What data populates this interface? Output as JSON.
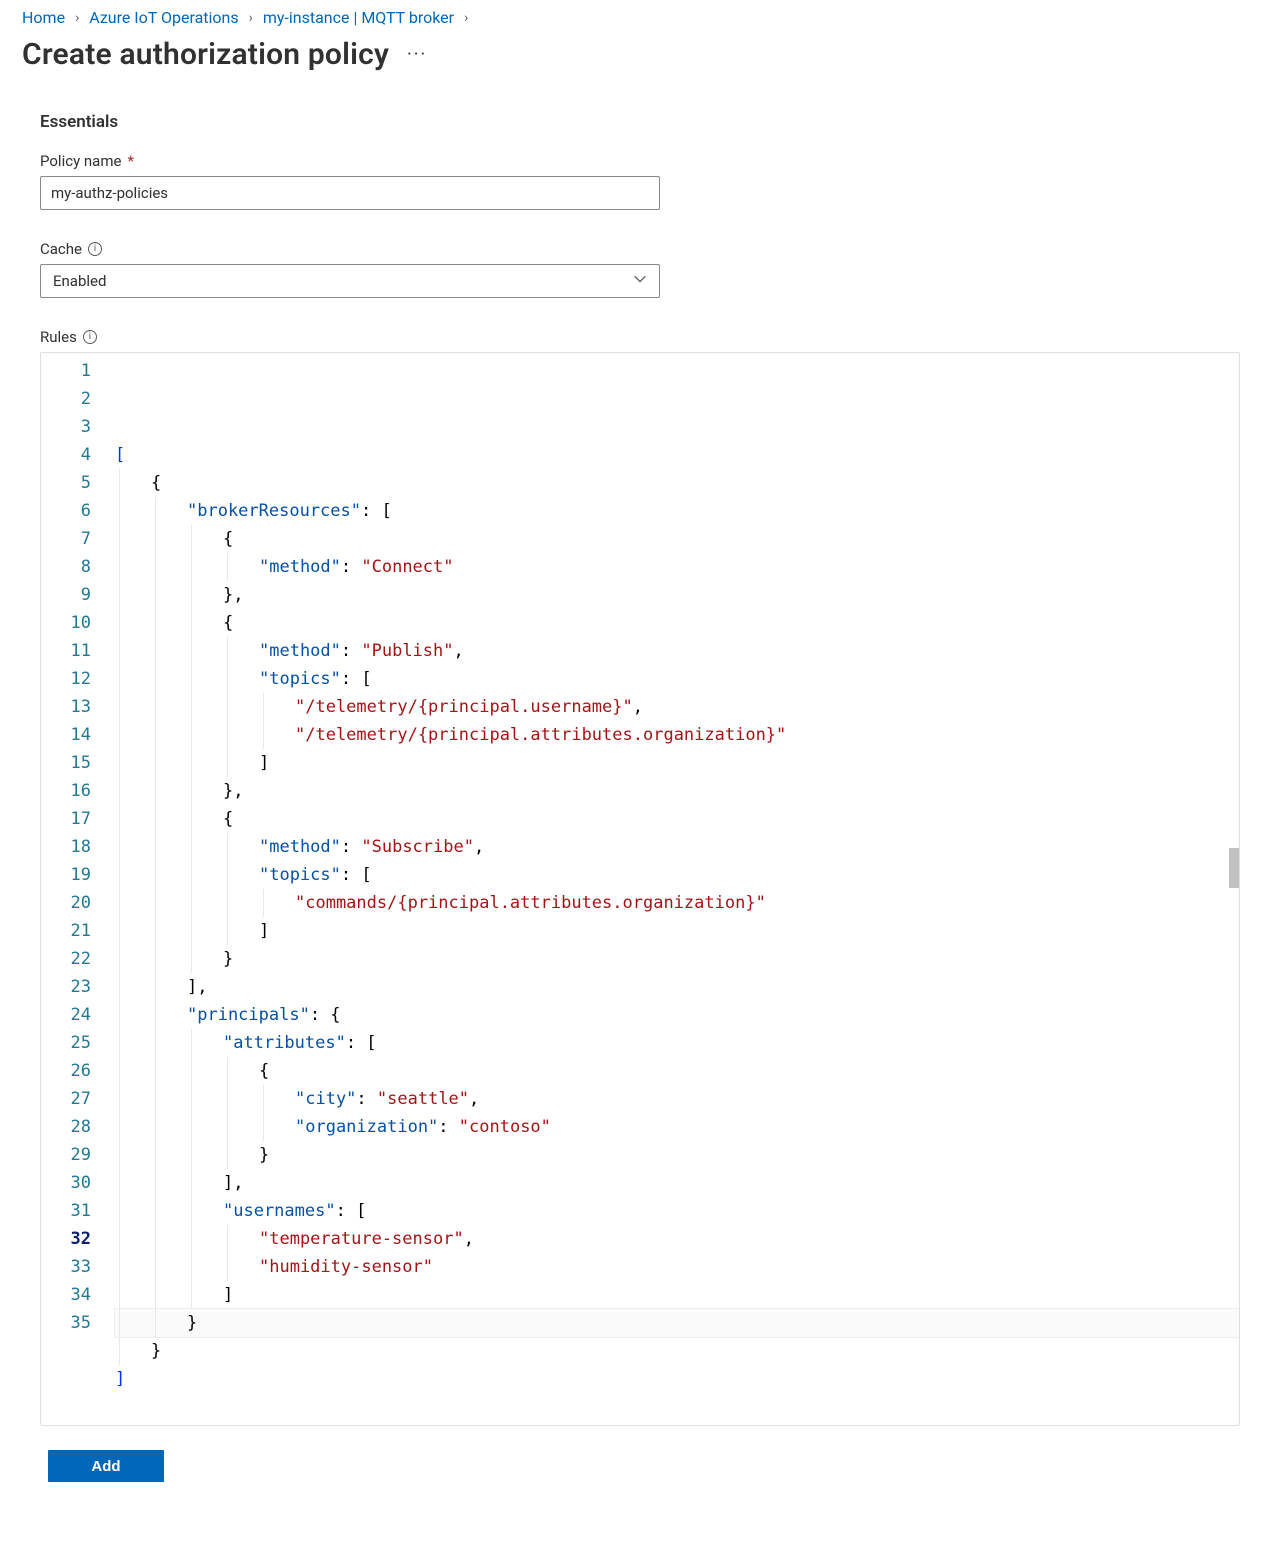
{
  "breadcrumbs": {
    "items": [
      {
        "label": "Home",
        "link": true
      },
      {
        "label": "Azure IoT Operations",
        "link": true
      },
      {
        "label": "my-instance | MQTT broker",
        "link": true
      }
    ]
  },
  "page": {
    "title": "Create authorization policy"
  },
  "essentials": {
    "heading": "Essentials",
    "policy_name_label": "Policy name",
    "policy_name_value": "my-authz-policies",
    "cache_label": "Cache",
    "cache_value": "Enabled"
  },
  "rules": {
    "label": "Rules"
  },
  "editor": {
    "current_line": 32,
    "lines": [
      {
        "n": 1,
        "indent": 0,
        "tokens": [
          [
            "brkt",
            "["
          ]
        ]
      },
      {
        "n": 2,
        "indent": 1,
        "tokens": [
          [
            "punc",
            "{"
          ]
        ]
      },
      {
        "n": 3,
        "indent": 2,
        "tokens": [
          [
            "prop",
            "\"brokerResources\""
          ],
          [
            "punc",
            ": ["
          ]
        ]
      },
      {
        "n": 4,
        "indent": 3,
        "tokens": [
          [
            "punc",
            "{"
          ]
        ]
      },
      {
        "n": 5,
        "indent": 4,
        "tokens": [
          [
            "prop",
            "\"method\""
          ],
          [
            "punc",
            ": "
          ],
          [
            "str",
            "\"Connect\""
          ]
        ]
      },
      {
        "n": 6,
        "indent": 3,
        "tokens": [
          [
            "punc",
            "},"
          ]
        ]
      },
      {
        "n": 7,
        "indent": 3,
        "tokens": [
          [
            "punc",
            "{"
          ]
        ]
      },
      {
        "n": 8,
        "indent": 4,
        "tokens": [
          [
            "prop",
            "\"method\""
          ],
          [
            "punc",
            ": "
          ],
          [
            "str",
            "\"Publish\""
          ],
          [
            "punc",
            ","
          ]
        ]
      },
      {
        "n": 9,
        "indent": 4,
        "tokens": [
          [
            "prop",
            "\"topics\""
          ],
          [
            "punc",
            ": ["
          ]
        ]
      },
      {
        "n": 10,
        "indent": 5,
        "tokens": [
          [
            "str",
            "\"/telemetry/{principal.username}\""
          ],
          [
            "punc",
            ","
          ]
        ]
      },
      {
        "n": 11,
        "indent": 5,
        "tokens": [
          [
            "str",
            "\"/telemetry/{principal.attributes.organization}\""
          ]
        ]
      },
      {
        "n": 12,
        "indent": 4,
        "tokens": [
          [
            "punc",
            "]"
          ]
        ]
      },
      {
        "n": 13,
        "indent": 3,
        "tokens": [
          [
            "punc",
            "},"
          ]
        ]
      },
      {
        "n": 14,
        "indent": 3,
        "tokens": [
          [
            "punc",
            "{"
          ]
        ]
      },
      {
        "n": 15,
        "indent": 4,
        "tokens": [
          [
            "prop",
            "\"method\""
          ],
          [
            "punc",
            ": "
          ],
          [
            "str",
            "\"Subscribe\""
          ],
          [
            "punc",
            ","
          ]
        ]
      },
      {
        "n": 16,
        "indent": 4,
        "tokens": [
          [
            "prop",
            "\"topics\""
          ],
          [
            "punc",
            ": ["
          ]
        ]
      },
      {
        "n": 17,
        "indent": 5,
        "tokens": [
          [
            "str",
            "\"commands/{principal.attributes.organization}\""
          ]
        ]
      },
      {
        "n": 18,
        "indent": 4,
        "tokens": [
          [
            "punc",
            "]"
          ]
        ]
      },
      {
        "n": 19,
        "indent": 3,
        "tokens": [
          [
            "punc",
            "}"
          ]
        ]
      },
      {
        "n": 20,
        "indent": 2,
        "tokens": [
          [
            "punc",
            "],"
          ]
        ]
      },
      {
        "n": 21,
        "indent": 2,
        "tokens": [
          [
            "prop",
            "\"principals\""
          ],
          [
            "punc",
            ": {"
          ]
        ]
      },
      {
        "n": 22,
        "indent": 3,
        "tokens": [
          [
            "prop",
            "\"attributes\""
          ],
          [
            "punc",
            ": ["
          ]
        ]
      },
      {
        "n": 23,
        "indent": 4,
        "tokens": [
          [
            "punc",
            "{"
          ]
        ]
      },
      {
        "n": 24,
        "indent": 5,
        "tokens": [
          [
            "prop",
            "\"city\""
          ],
          [
            "punc",
            ": "
          ],
          [
            "str",
            "\"seattle\""
          ],
          [
            "punc",
            ","
          ]
        ]
      },
      {
        "n": 25,
        "indent": 5,
        "tokens": [
          [
            "prop",
            "\"organization\""
          ],
          [
            "punc",
            ": "
          ],
          [
            "str",
            "\"contoso\""
          ]
        ]
      },
      {
        "n": 26,
        "indent": 4,
        "tokens": [
          [
            "punc",
            "}"
          ]
        ]
      },
      {
        "n": 27,
        "indent": 3,
        "tokens": [
          [
            "punc",
            "],"
          ]
        ]
      },
      {
        "n": 28,
        "indent": 3,
        "tokens": [
          [
            "prop",
            "\"usernames\""
          ],
          [
            "punc",
            ": ["
          ]
        ]
      },
      {
        "n": 29,
        "indent": 4,
        "tokens": [
          [
            "str",
            "\"temperature-sensor\""
          ],
          [
            "punc",
            ","
          ]
        ]
      },
      {
        "n": 30,
        "indent": 4,
        "tokens": [
          [
            "str",
            "\"humidity-sensor\""
          ]
        ]
      },
      {
        "n": 31,
        "indent": 3,
        "tokens": [
          [
            "punc",
            "]"
          ]
        ]
      },
      {
        "n": 32,
        "indent": 2,
        "tokens": [
          [
            "punc",
            "}"
          ]
        ]
      },
      {
        "n": 33,
        "indent": 1,
        "tokens": [
          [
            "punc",
            "}"
          ]
        ]
      },
      {
        "n": 34,
        "indent": 0,
        "tokens": [
          [
            "brkt",
            "]"
          ]
        ]
      },
      {
        "n": 35,
        "indent": 0,
        "tokens": []
      }
    ]
  },
  "footer": {
    "add_label": "Add"
  }
}
